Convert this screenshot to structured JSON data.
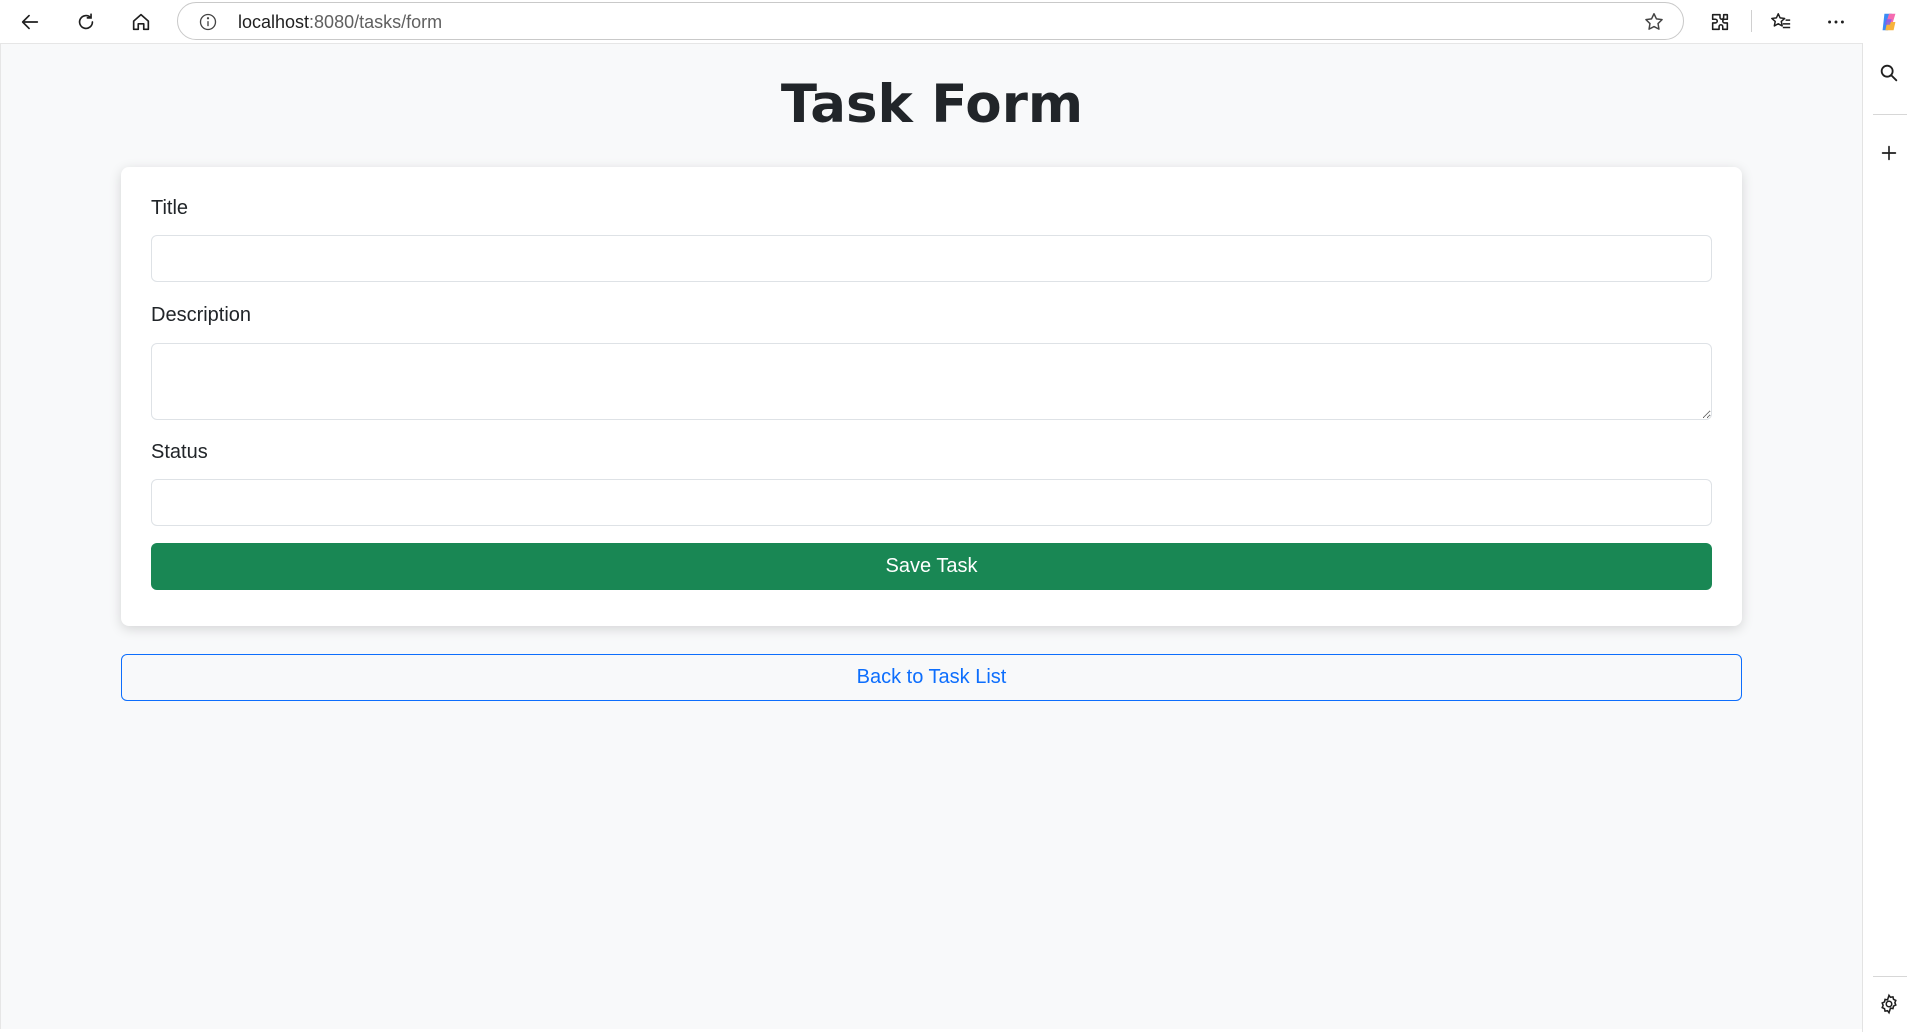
{
  "browser": {
    "url_host": "localhost",
    "url_rest": ":8080/tasks/form",
    "icons": [
      "back-arrow-icon",
      "reload-icon",
      "home-icon",
      "info-icon",
      "star-icon",
      "extensions-icon",
      "favorites-icon",
      "more-icon",
      "copilot-icon",
      "search-icon",
      "plus-icon",
      "gear-icon"
    ]
  },
  "page": {
    "title": "Task Form",
    "form": {
      "title_label": "Title",
      "title_value": "",
      "description_label": "Description",
      "description_value": "",
      "status_label": "Status",
      "status_value": "",
      "save_label": "Save Task"
    },
    "back_label": "Back to Task List"
  },
  "colors": {
    "page_bg": "#f8f9fa",
    "save_button": "#198754",
    "back_button": "#0d6efd"
  }
}
